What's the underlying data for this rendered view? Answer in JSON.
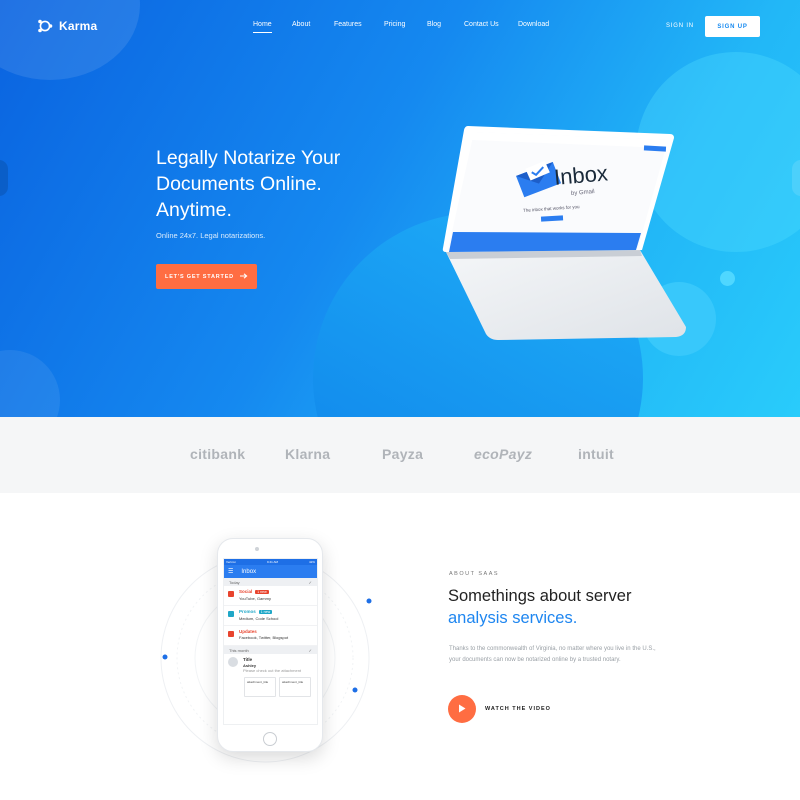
{
  "brand": {
    "name": "Karma"
  },
  "nav": {
    "items": [
      {
        "label": "Home",
        "active": true
      },
      {
        "label": "About"
      },
      {
        "label": "Features"
      },
      {
        "label": "Pricing"
      },
      {
        "label": "Blog"
      },
      {
        "label": "Contact Us"
      },
      {
        "label": "Download"
      }
    ],
    "sign_in": "SIGN IN",
    "sign_up": "SIGN UP"
  },
  "hero": {
    "title_lines": [
      "Legally Notarize Your",
      "Documents Online.",
      "Anytime."
    ],
    "subtitle": "Online 24x7. Legal notarizations.",
    "cta": "LET'S GET STARTED",
    "screen": {
      "app": "Inbox",
      "sub": "by Gmail",
      "tagline": "The inbox that works for you"
    }
  },
  "partners": [
    "citibank",
    "Klarna",
    "Payza",
    "ecoPayz",
    "intuit"
  ],
  "phone": {
    "status_left": "Verizon",
    "status_time": "9:41 AM",
    "status_right": "42%",
    "title": "Inbox",
    "section_today": "Today",
    "section_week": "This month",
    "items": [
      {
        "category": "Social",
        "badge": "1 new",
        "badge_color": "#e8442e",
        "icon_color": "#e8442e",
        "line": "YouTube, Gammy"
      },
      {
        "category": "Promos",
        "badge": "1 new",
        "badge_color": "#1fa7c7",
        "icon_color": "#1fa7c7",
        "line": "Medium, Code School"
      },
      {
        "category": "Updates",
        "badge": "",
        "badge_color": "",
        "icon_color": "#e8442e",
        "line": "Facebook, Twitter, Blogspot"
      }
    ],
    "mail": {
      "subject": "Title",
      "from": "Ashley",
      "preview": "Please check out the attachment"
    },
    "attachments": [
      "attachment_title",
      "attachment_title"
    ],
    "fab": "+"
  },
  "about": {
    "kicker": "ABOUT SAAS",
    "title_line1": "Somethings about server",
    "title_line2": "analysis services.",
    "body": "Thanks to the commonwealth of Virginia, no matter where you live in the U.S., your documents can now be notarized online by a trusted notary.",
    "video_label": "WATCH THE VIDEO"
  },
  "colors": {
    "hero_start": "#0a63e0",
    "hero_end": "#29ccfb",
    "accent": "#ff6d42",
    "highlight": "#1e86f0"
  }
}
